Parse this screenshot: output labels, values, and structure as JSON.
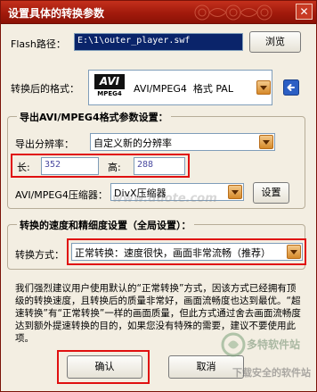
{
  "window": {
    "title": "设置具体的转换参数",
    "close_icon": "close-icon"
  },
  "flash": {
    "label": "Flash路径：",
    "path_value": "E:\\1\\outer_player.swf",
    "browse_label": "浏览"
  },
  "format": {
    "label": "转换后的格式：",
    "logo_text": "AVI",
    "logo_subtext": "MPEG4",
    "selected": "AVI/MPEG4  格式 PAL",
    "back_icon": "back-arrow-icon"
  },
  "export_group": {
    "title": "导出AVI/MPEG4格式参数设置：",
    "resolution_label": "导出分辨率：",
    "resolution_value": "自定义新的分辨率",
    "length_label": "长:",
    "length_value": "352",
    "height_label": "高:",
    "height_value": "288",
    "compressor_label": "AVI/MPEG4压缩器：",
    "compressor_value": "DivX压缩器",
    "settings_label": "设置"
  },
  "speed_group": {
    "title": "转换的速度和精细度设置（全局设置）：",
    "mode_label": "转换方式：",
    "mode_value": "正常转换：速度很快，画面非常流畅（推荐）"
  },
  "info_text": "我们强烈建议用户使用默认的“正常转换”方式，因该方式已经拥有顶级的转换速度，且转换后的质量非常好，画面流畅度也达到最优。“超速转换”有“正常转换”一样的画面质量，但此方式通过舍去画面流畅度达到额外提速转换的目的，如果您没有特殊的需要，建议不要使用此项。",
  "buttons": {
    "ok": "确认",
    "cancel": "取消"
  },
  "watermarks": {
    "site": "www.duote.com",
    "brand_logo": "多特软件站",
    "brand_slogan": "下载安全的软件站"
  },
  "colors": {
    "title_bar": "#a11a0c",
    "highlight_box": "#e01010",
    "combo_arrow": "#d68a2a"
  }
}
